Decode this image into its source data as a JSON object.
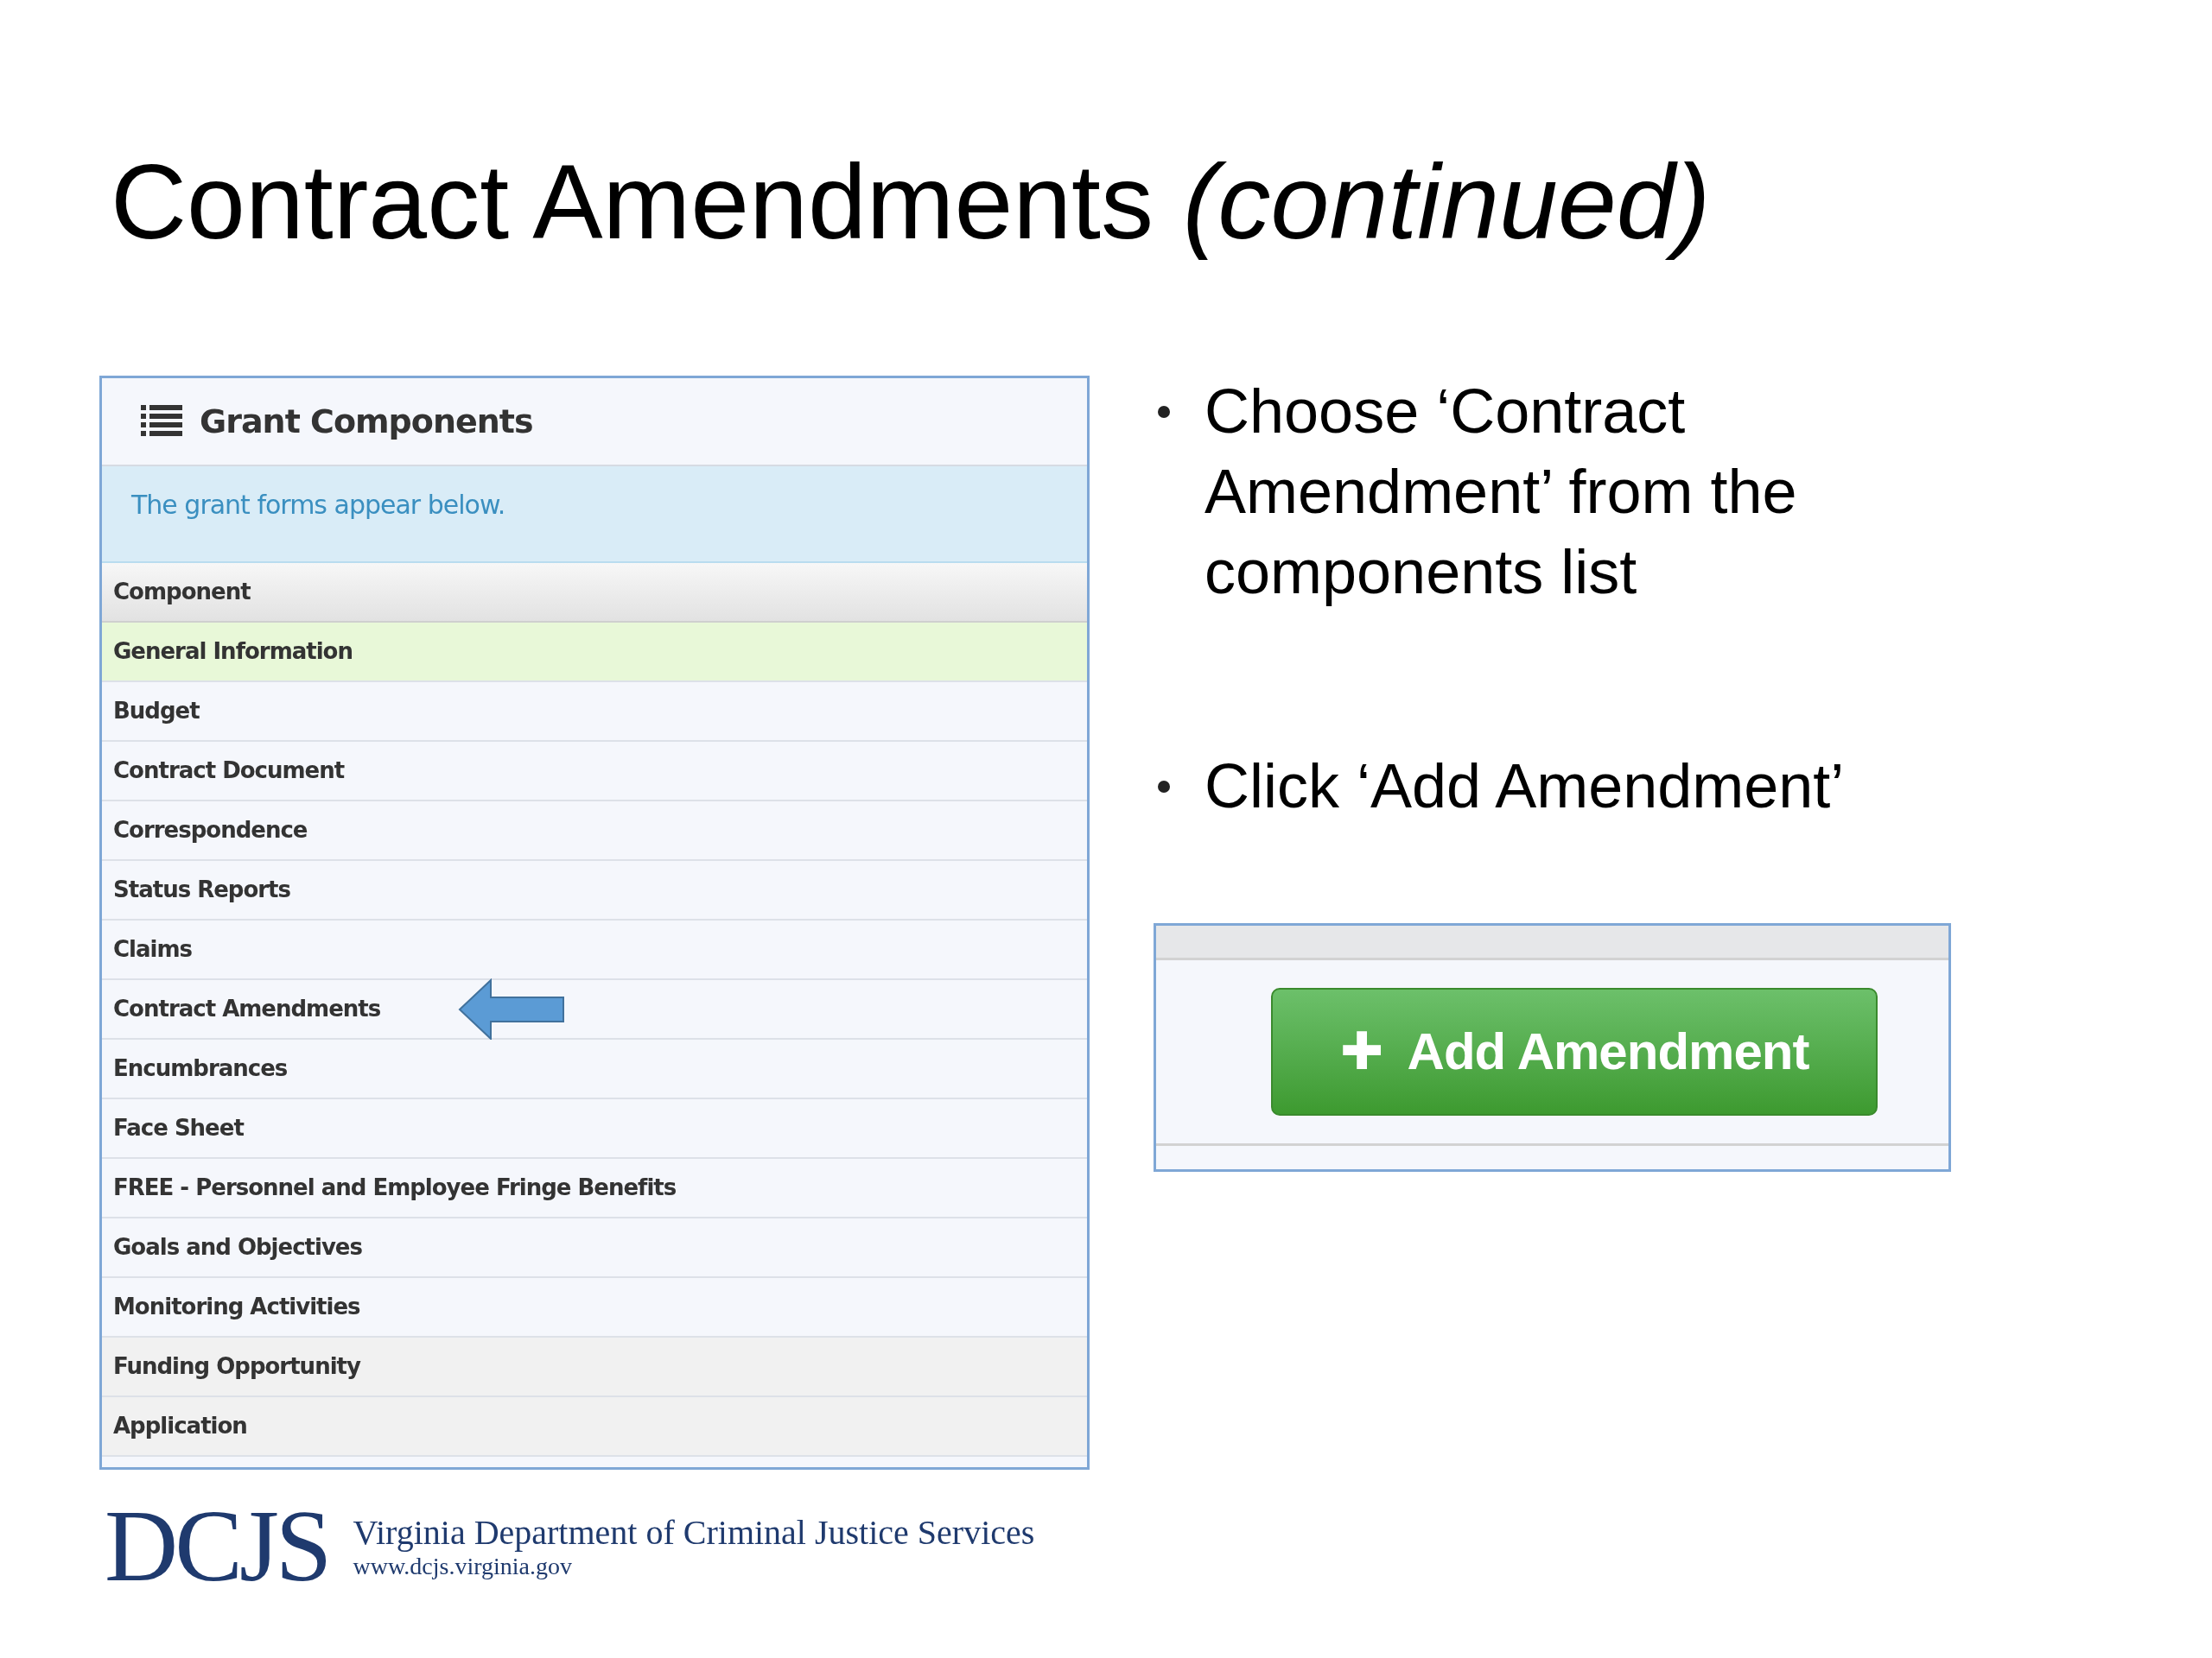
{
  "slide_title": "Contract Amendments *(continued)*",
  "panel": {
    "title": "Grant Components",
    "info": "The grant forms appear below.",
    "column": "Component",
    "rows": [
      {
        "label": "General Information",
        "selected": true,
        "kind": "item",
        "pointer": false
      },
      {
        "label": "Budget",
        "selected": false,
        "kind": "item",
        "pointer": false
      },
      {
        "label": "Contract Document",
        "selected": false,
        "kind": "item",
        "pointer": false
      },
      {
        "label": "Correspondence",
        "selected": false,
        "kind": "item",
        "pointer": false
      },
      {
        "label": "Status Reports",
        "selected": false,
        "kind": "item",
        "pointer": false
      },
      {
        "label": "Claims",
        "selected": false,
        "kind": "item",
        "pointer": false
      },
      {
        "label": "Contract Amendments",
        "selected": false,
        "kind": "item",
        "pointer": true
      },
      {
        "label": "Encumbrances",
        "selected": false,
        "kind": "item",
        "pointer": false
      },
      {
        "label": "Face Sheet",
        "selected": false,
        "kind": "item",
        "pointer": false
      },
      {
        "label": "FREE - Personnel and Employee Fringe Benefits",
        "selected": false,
        "kind": "item",
        "pointer": false
      },
      {
        "label": "Goals and Objectives",
        "selected": false,
        "kind": "item",
        "pointer": false
      },
      {
        "label": "Monitoring Activities",
        "selected": false,
        "kind": "item",
        "pointer": false
      },
      {
        "label": "Funding Opportunity",
        "selected": false,
        "kind": "shaded",
        "pointer": false
      },
      {
        "label": "Application",
        "selected": false,
        "kind": "shaded",
        "pointer": false
      }
    ]
  },
  "bullets": [
    "Choose ‘Contract Amendment’ from the components list",
    "Click ‘Add Amendment’"
  ],
  "add_button": {
    "label": "Add Amendment",
    "icon": "✚"
  },
  "logo": {
    "mark": "DCJS",
    "name": "Virginia Department of Criminal Justice Services",
    "url": "www.dcjs.virginia.gov"
  }
}
